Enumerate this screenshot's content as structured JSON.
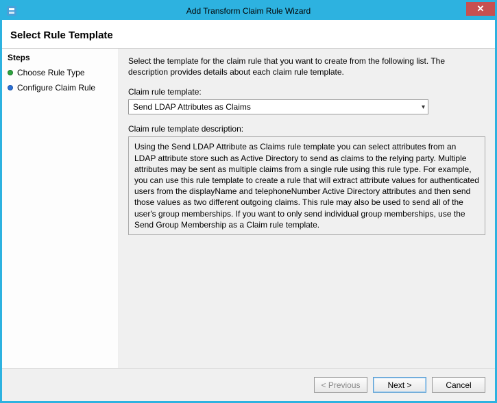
{
  "window": {
    "title": "Add Transform Claim Rule Wizard"
  },
  "header": {
    "title": "Select Rule Template"
  },
  "sidebar": {
    "header": "Steps",
    "items": [
      {
        "label": "Choose Rule Type",
        "state": "done"
      },
      {
        "label": "Configure Claim Rule",
        "state": "current"
      }
    ]
  },
  "main": {
    "intro": "Select the template for the claim rule that you want to create from the following list. The description provides details about each claim rule template.",
    "templateLabel": "Claim rule template:",
    "templateSelected": "Send LDAP Attributes as Claims",
    "descLabel": "Claim rule template description:",
    "descText": "Using the Send LDAP Attribute as Claims rule template you can select attributes from an LDAP attribute store such as Active Directory to send as claims to the relying party. Multiple attributes may be sent as multiple claims from a single rule using this rule type. For example, you can use this rule template to create a rule that will extract attribute values for authenticated users from the displayName and telephoneNumber Active Directory attributes and then send those values as two different outgoing claims. This rule may also be used to send all of the user's group memberships. If you want to only send individual group memberships, use the Send Group Membership as a Claim rule template."
  },
  "footer": {
    "previous": "< Previous",
    "next": "Next >",
    "cancel": "Cancel"
  }
}
